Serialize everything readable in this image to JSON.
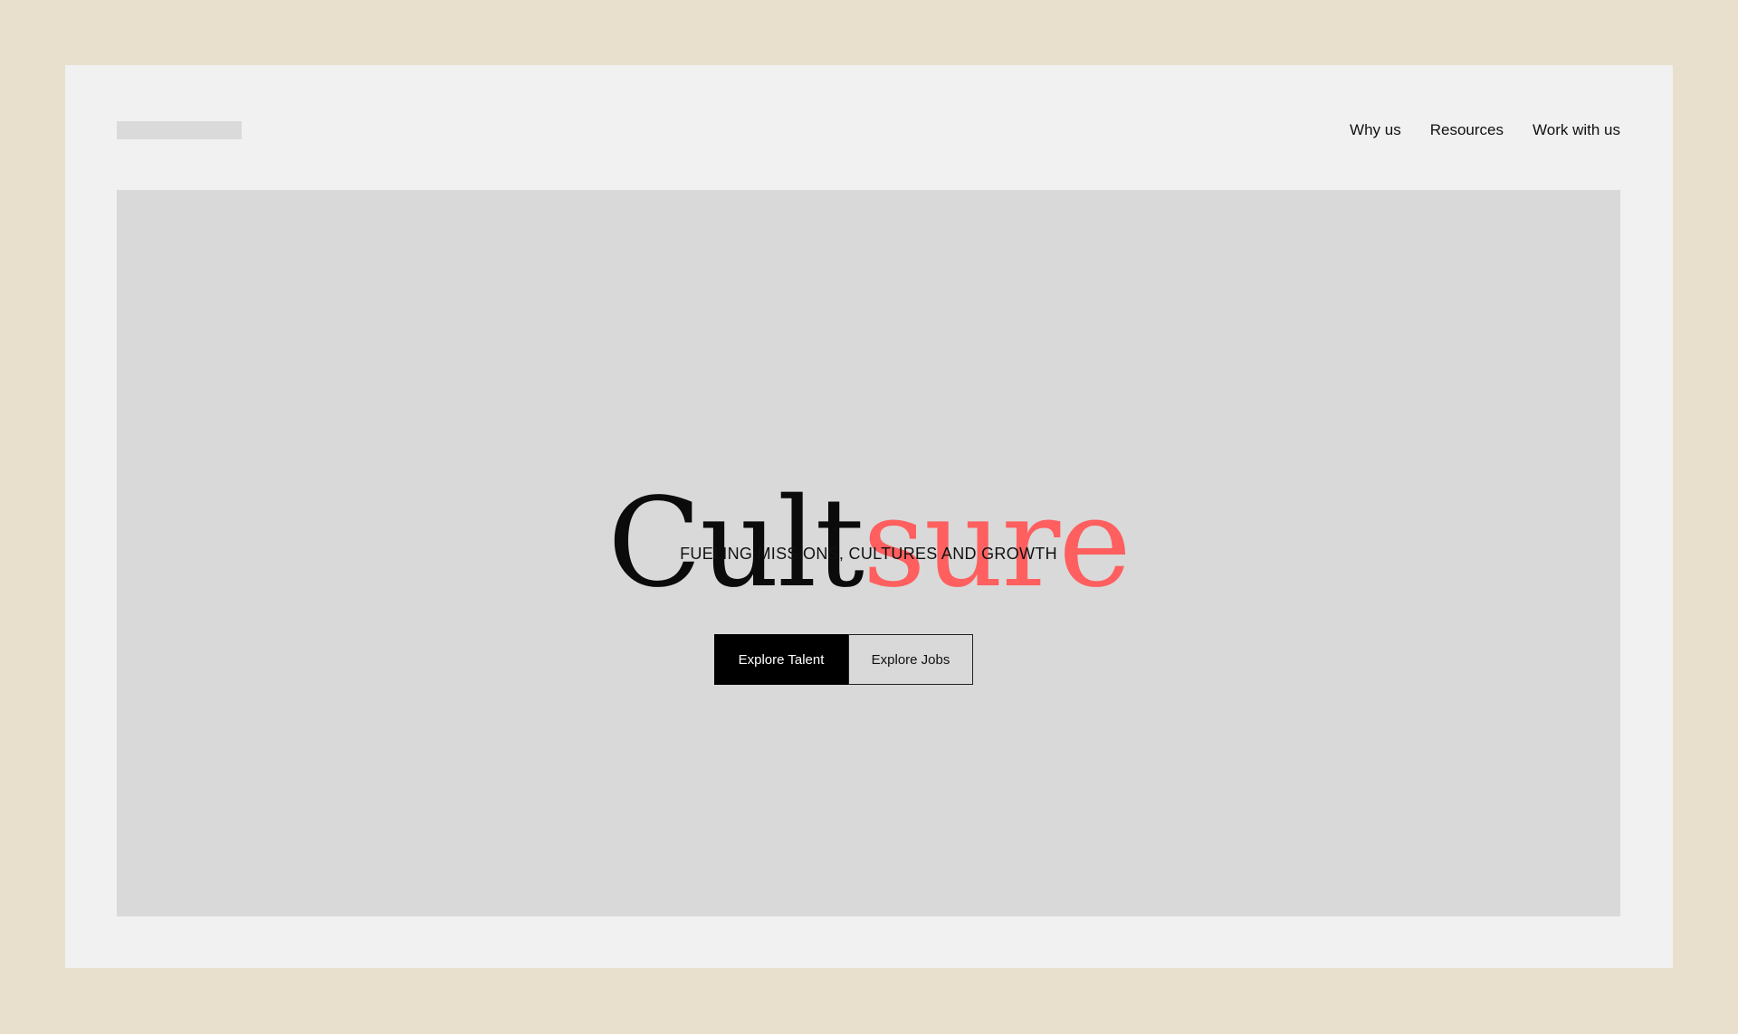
{
  "nav": {
    "items": [
      {
        "label": "Why us"
      },
      {
        "label": "Resources"
      },
      {
        "label": "Work with us"
      }
    ]
  },
  "hero": {
    "brand_part1": "Cult",
    "brand_part2": "sure",
    "tagline": "FUELING MISSIONS, CULTURES AND GROWTH",
    "primary_button": "Explore Talent",
    "secondary_button": "Explore Jobs"
  },
  "colors": {
    "page_background": "#e8e0cd",
    "frame_background": "#f1f1f1",
    "hero_background": "#d9d9d9",
    "accent": "#ff5f5f",
    "primary_button": "#000000"
  }
}
